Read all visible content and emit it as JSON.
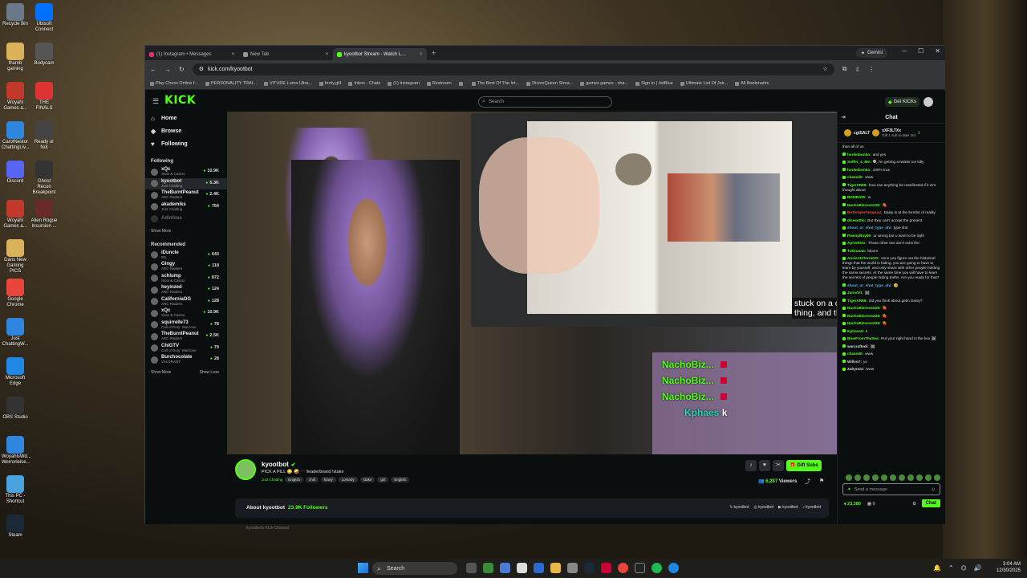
{
  "desktop": {
    "icons": [
      {
        "label": "Recycle Bin",
        "color": "#6a7a8a"
      },
      {
        "label": "thumb gaming",
        "color": "#d9b25a"
      },
      {
        "label": "Woyahl Games a...",
        "color": "#c0392b"
      },
      {
        "label": "CarolNestor ChattingLiv...",
        "color": "#2e86de"
      },
      {
        "label": "Discord",
        "color": "#5865f2"
      },
      {
        "label": "Woyahl Games a...",
        "color": "#c0392b"
      },
      {
        "label": "Dans New Gaming PICS",
        "color": "#d9b25a"
      },
      {
        "label": "Google Chrome",
        "color": "#e8453c"
      },
      {
        "label": "Just ChattingW...",
        "color": "#2e86de"
      },
      {
        "label": "Microsoft Edge",
        "color": "#1e88e5"
      },
      {
        "label": "OBS Studio",
        "color": "#333"
      },
      {
        "label": "WoyahlsWd... Werrorlelse...",
        "color": "#2e86de"
      },
      {
        "label": "This PC - Shortcut",
        "color": "#4aa3df"
      },
      {
        "label": "Steam",
        "color": "#1b2838"
      }
    ],
    "icons2": [
      {
        "label": "Ubisoft Connect",
        "color": "#0070ff"
      },
      {
        "label": "Bodycam",
        "color": "#555"
      },
      {
        "label": "THE FINALS",
        "color": "#d33"
      },
      {
        "label": "Ready or Not",
        "color": "#444"
      },
      {
        "label": "Ghost Recon Breakpoint",
        "color": "#333"
      },
      {
        "label": "Alien Rogue Incursion ...",
        "color": "#6a2a2a"
      }
    ]
  },
  "browser": {
    "tabs": [
      {
        "label": "(1) Instagram • Messages",
        "color": "#e1306c"
      },
      {
        "label": "New Tab",
        "color": "#888"
      },
      {
        "label": "kyootbot Stream - Watch L...",
        "color": "#53fc18"
      }
    ],
    "gemini": "Gemini",
    "url": "kick.com/kyootbot",
    "bookmarks": [
      "Play Chess Online f...",
      "PERSONALITY TRAI...",
      "VITURE Luma Ultra...",
      "fenty.gl4",
      "Inbox - Chats",
      "(1) Instagram",
      "Restream",
      "",
      "The Best Of The Int...",
      "DicienQueen Strea...",
      "games games - sha...",
      "Sign in | JetBlue",
      "Ultimate List Of Jok...",
      "All Bookmarks"
    ]
  },
  "kick": {
    "logo": "KICK",
    "search_placeholder": "Search",
    "get_kicks": "Get KICKs",
    "nav": [
      {
        "label": "Home",
        "icon": "⌂"
      },
      {
        "label": "Browse",
        "icon": "◈"
      },
      {
        "label": "Following",
        "icon": "♥"
      }
    ],
    "following_header": "Following",
    "following": [
      {
        "name": "xQc",
        "cat": "Slots & Casino",
        "views": "10.9K"
      },
      {
        "name": "kyootbot",
        "cat": "Just Chatting",
        "views": "6.3K"
      },
      {
        "name": "TheBurntPeanut",
        "cat": "ARC Raiders",
        "views": "2.4K"
      },
      {
        "name": "akademiks",
        "cat": "Just Chatting",
        "views": "754"
      },
      {
        "name": "Adinfoss",
        "cat": "",
        "views": ""
      }
    ],
    "show_more": "Show More",
    "recommended_header": "Recommended",
    "recommended": [
      {
        "name": "iDuncle",
        "cat": "IRL",
        "views": "643"
      },
      {
        "name": "Gingy",
        "cat": "ARC Raiders",
        "views": "118"
      },
      {
        "name": "schlump",
        "cat": "Slots & Casino",
        "views": "872"
      },
      {
        "name": "heyinzed",
        "cat": "ARC Raiders",
        "views": "124"
      },
      {
        "name": "CaliforniaOG",
        "cat": "ARC Raiders",
        "views": "128"
      },
      {
        "name": "xQc",
        "cat": "Slots & Casino",
        "views": "10.9K"
      },
      {
        "name": "squirrelle73",
        "cat": "Call of Duty: Warzone",
        "views": "78"
      },
      {
        "name": "TheBurntPeanut",
        "cat": "ARC Raiders",
        "views": "2.5K"
      },
      {
        "name": "ChiGTV",
        "cat": "Call of Duty: Warzone",
        "views": "79"
      },
      {
        "name": "Burchocolate",
        "cat": "VALORANT",
        "views": "28"
      }
    ],
    "show_more2": "Show More",
    "show_less": "Show Less",
    "caption": "stuck on a certain belief, a certain thing, and they're not open to",
    "overlay_names": [
      "NachoBiz...",
      "NachoBiz...",
      "NachoBiz...",
      "Kphaes"
    ],
    "overlay_k": "k",
    "channel": {
      "name": "kyootbot",
      "title": "PICK A PILL 😳 🤪 ⋯ !leaderboard !stake",
      "category": "Just Chatting",
      "tags": [
        "English",
        "chill",
        "funny",
        "comedy",
        "stake",
        "girl",
        "English"
      ],
      "gift_subs": "Gift Subs",
      "viewers": "6,287",
      "viewers_label": "Viewers",
      "about": "About kyootbot",
      "followers": "23.9K Followers",
      "socials": [
        "kyootbot",
        "kyootbot",
        "kyootbot",
        "kyootbot"
      ],
      "kick_channel": "kyootbot's Kick Channel"
    },
    "chat": {
      "header": "Chat",
      "pinned": {
        "u1": "cgtSALT",
        "u2": "xXF3LTXx",
        "count": "1",
        "sub": "Gift 1 sub to take 3rd"
      },
      "messages": [
        {
          "u": "",
          "t": "than all of us",
          "c": "#ddd"
        },
        {
          "u": "honkobonko:",
          "t": "and yes",
          "c": "#53fc18"
        },
        {
          "u": "Soffer_4_Me:",
          "t": "🍭 I'm getting a twister ice lolly",
          "c": "#53fc18"
        },
        {
          "u": "honkobonko:",
          "t": "100% true",
          "c": "#53fc18"
        },
        {
          "u": "chazed0:",
          "t": "www",
          "c": "#53fc18"
        },
        {
          "u": "TigerAR86:",
          "t": "how can anything be manifested if it isnt thought about",
          "c": "#53fc18"
        },
        {
          "u": "BGMENtS:",
          "t": "w",
          "c": "#53fc18"
        },
        {
          "u": "NachoBizness228:",
          "t": "🍓",
          "c": "#53fc18"
        },
        {
          "u": "BoTemperTempust:",
          "t": "Daisy is at the forefint of reality",
          "c": "#e74c3c"
        },
        {
          "u": "dicesettic:",
          "t": "But they can't accept the present",
          "c": "#53fc18"
        },
        {
          "u": "shoot_ur_shot_type_shi:",
          "t": "type shit",
          "c": "#5dade2"
        },
        {
          "u": "PawnyBoy69:",
          "t": "ur wrong but u want to be right",
          "c": "#53fc18"
        },
        {
          "u": "AprioReio:",
          "t": "Those other two don't exist tho",
          "c": "#53fc18"
        },
        {
          "u": "Tukinauta:",
          "t": "bloom",
          "c": "#53fc18"
        },
        {
          "u": "AncientsTerraOG:",
          "t": "once you figure out the historical things that the world is hiding, you are going to have to learn by yourself, and only share with other people holding the same secrets. At the same time you will have to learn the secrets of people hiding truths. Are you ready for that?",
          "c": "#53fc18"
        },
        {
          "u": "shoot_ur_shot_type_shi:",
          "t": "🥹",
          "c": "#5dade2"
        },
        {
          "u": "JarevVit:",
          "t": "🖼",
          "c": "#53fc18"
        },
        {
          "u": "TigerAR86:",
          "t": "did you think about getin Daisy?",
          "c": "#53fc18"
        },
        {
          "u": "NachoBizness228:",
          "t": "🍓",
          "c": "#53fc18"
        },
        {
          "u": "NachoBizness228:",
          "t": "🍓",
          "c": "#53fc18"
        },
        {
          "u": "NachoBizness228:",
          "t": "🍓",
          "c": "#53fc18"
        },
        {
          "u": "Kphaes5:",
          "t": "k",
          "c": "#53fc18"
        },
        {
          "u": "BlueFromTheSea:",
          "t": "Put your right hand in the box 🖼",
          "c": "#53fc18"
        },
        {
          "u": "warcraftedi:",
          "t": "🖼",
          "c": "#ddd"
        },
        {
          "u": "chazed0:",
          "t": "www",
          "c": "#53fc18"
        },
        {
          "u": "Willvo7:",
          "t": "yo",
          "c": "#ddd"
        },
        {
          "u": "Zahymar:",
          "t": "www",
          "c": "#ddd"
        }
      ],
      "input_placeholder": "Send a message",
      "points": "23,380",
      "zero": "0",
      "send": "Chat"
    }
  },
  "taskbar": {
    "search": "Search",
    "time": "3:04 AM",
    "date": "12/30/2025"
  }
}
